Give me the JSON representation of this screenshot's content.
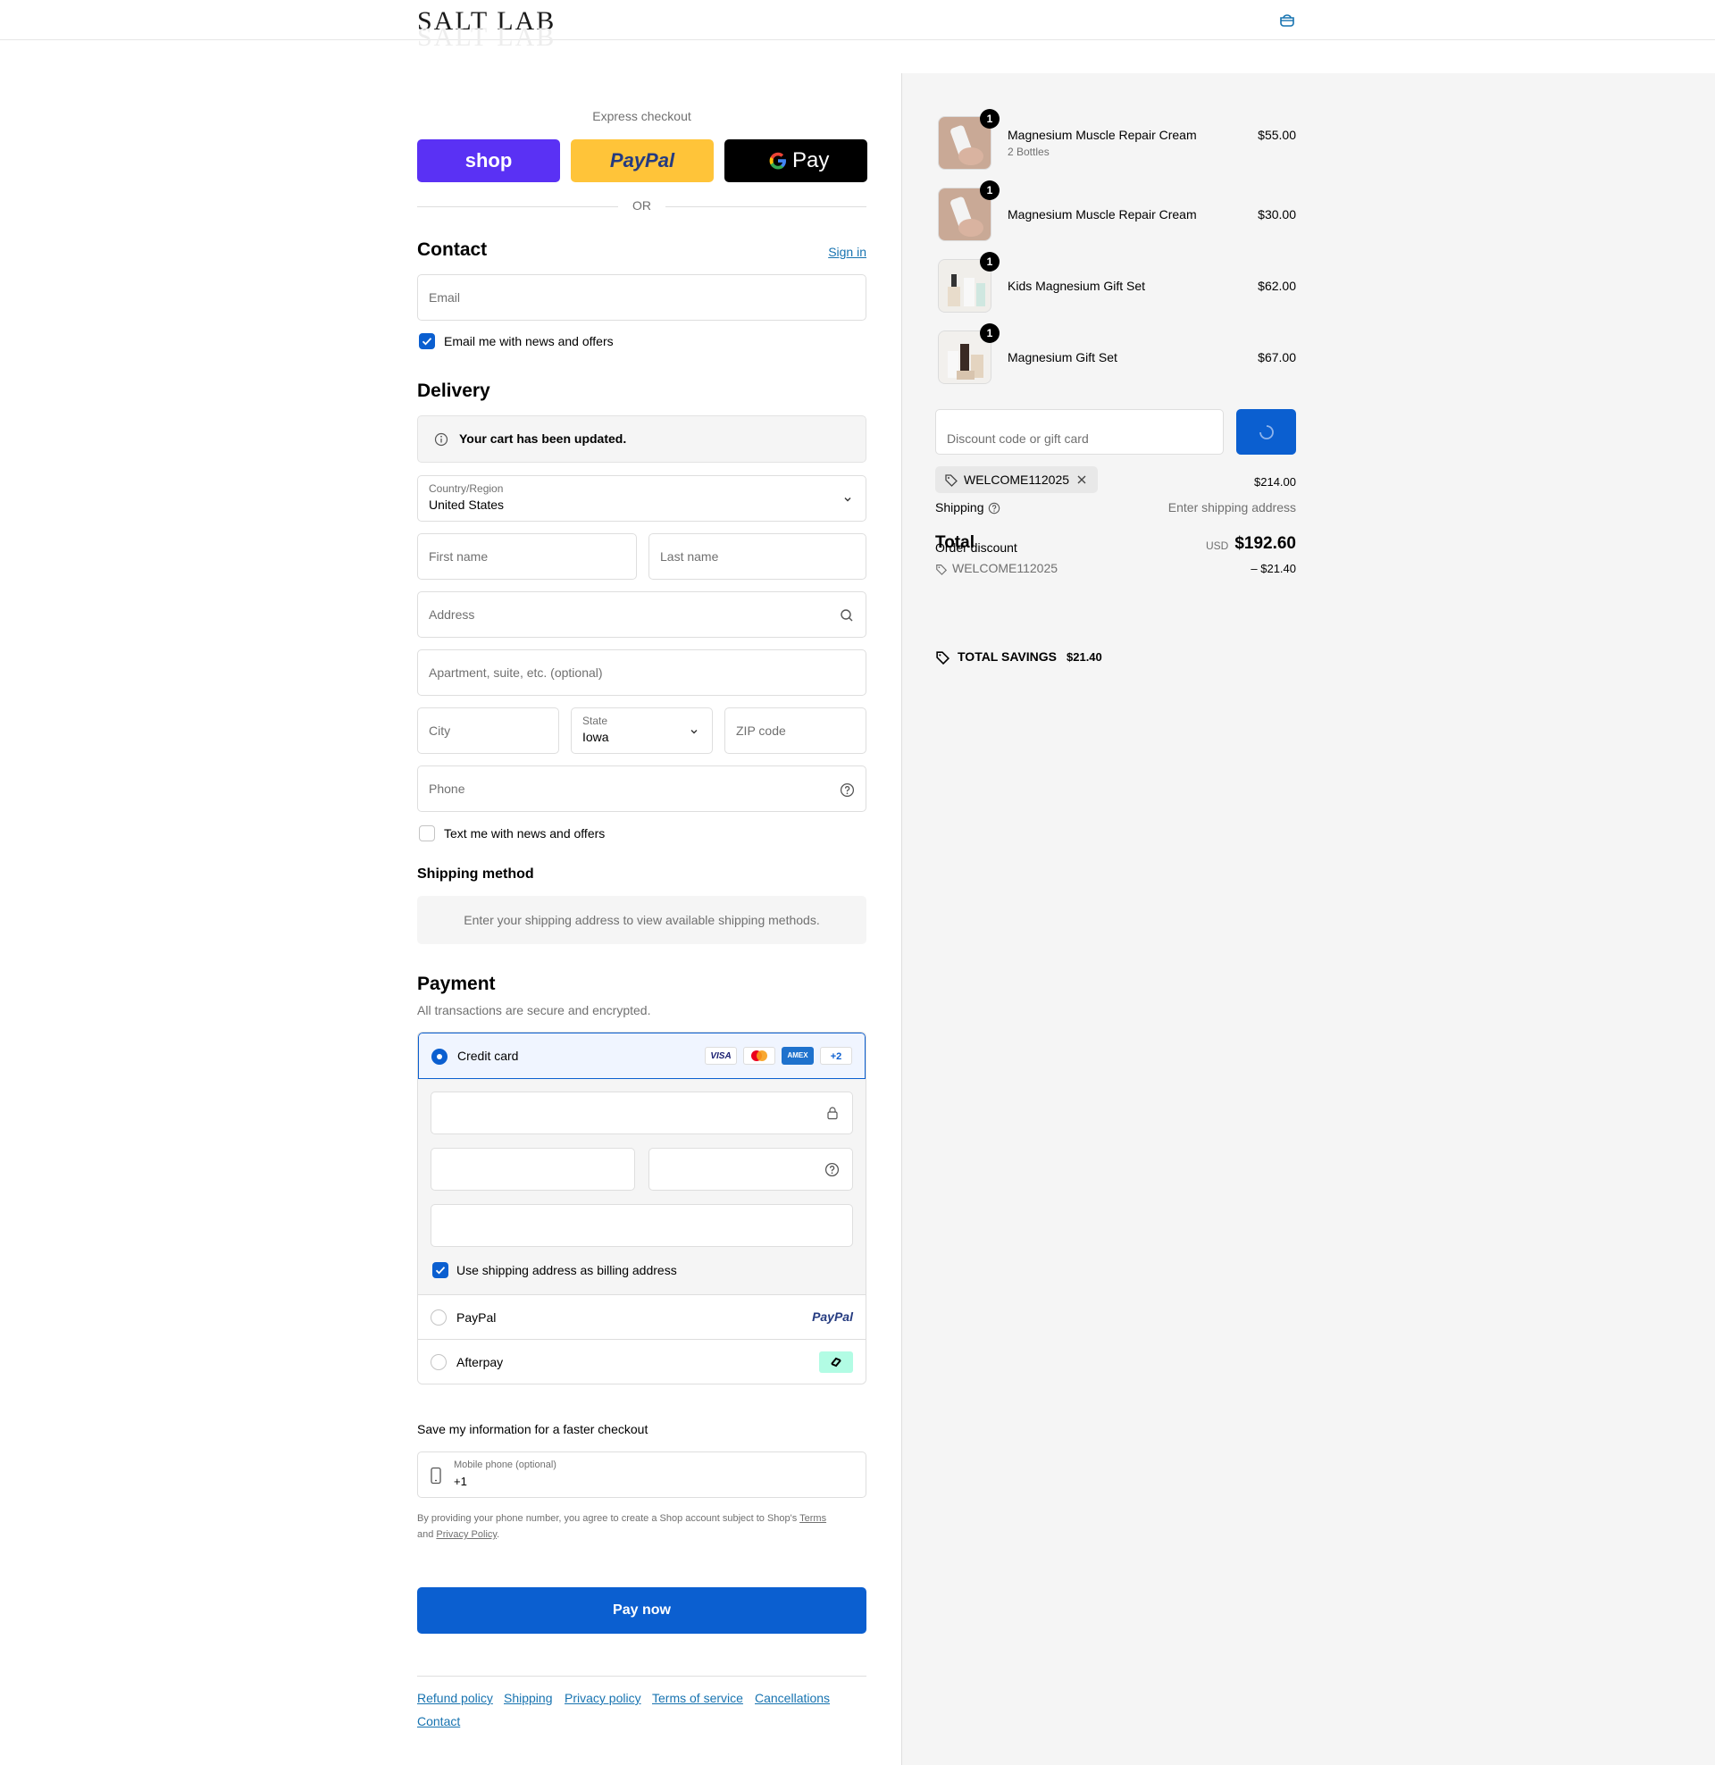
{
  "brand": {
    "logo": "SALT LAB"
  },
  "icons": {
    "cart": "shopping-bag-icon"
  },
  "express": {
    "title": "Express checkout",
    "shop_label": "shop",
    "paypal_label": "PayPal",
    "gpay_label": "Pay",
    "or": "OR"
  },
  "contact": {
    "heading": "Contact",
    "sign_in": "Sign in",
    "email_placeholder": "Email",
    "news_label": "Email me with news and offers"
  },
  "delivery": {
    "heading": "Delivery",
    "notice": "Your cart has been updated.",
    "country_label": "Country/Region",
    "country_value": "United States",
    "first_name": "First name",
    "last_name": "Last name",
    "address": "Address",
    "apartment": "Apartment, suite, etc. (optional)",
    "city": "City",
    "state_label": "State",
    "state_value": "Iowa",
    "zip": "ZIP code",
    "phone": "Phone",
    "text_label": "Text me with news and offers"
  },
  "shipping_method": {
    "heading": "Shipping method",
    "message": "Enter your shipping address to view available shipping methods."
  },
  "payment": {
    "heading": "Payment",
    "subtitle": "All transactions are secure and encrypted.",
    "credit_card": "Credit card",
    "cards": [
      "VISA",
      "MC",
      "AMEX",
      "+2"
    ],
    "billing_label": "Use shipping address as billing address",
    "paypal": "PayPal",
    "paypal_logo": "PayPal",
    "afterpay": "Afterpay"
  },
  "save_info": {
    "heading": "Save my information for a faster checkout",
    "mobile_label": "Mobile phone (optional)",
    "mobile_value": "+1",
    "disclaimer_pre": "By providing your phone number, you agree to create a Shop account subject to Shop's ",
    "terms": "Terms",
    "and": "and ",
    "privacy": "Privacy Policy",
    "period": "."
  },
  "pay_now": "Pay now",
  "footer_links": [
    "Refund policy",
    "Shipping",
    "Privacy policy",
    "Terms of service",
    "Cancellations",
    "Contact"
  ],
  "cart": {
    "items": [
      {
        "name": "Magnesium Muscle Repair Cream",
        "variant": "2 Bottles",
        "price": "$55.00",
        "qty": "1"
      },
      {
        "name": "Magnesium Muscle Repair Cream",
        "variant": "",
        "price": "$30.00",
        "qty": "1"
      },
      {
        "name": "Kids Magnesium Gift Set",
        "variant": "",
        "price": "$62.00",
        "qty": "1"
      },
      {
        "name": "Magnesium Gift Set",
        "variant": "",
        "price": "$67.00",
        "qty": "1"
      }
    ],
    "discount_placeholder": "Discount code or gift card",
    "applied_code": "WELCOME112025",
    "subtotal_value": "$214.00",
    "shipping_label": "Shipping",
    "shipping_value": "Enter shipping address",
    "total_label": "Total",
    "currency": "USD",
    "total_value": "$192.60",
    "order_discount_label": "Order discount",
    "discount_code": "WELCOME112025",
    "discount_value": "– $21.40",
    "savings_label": "TOTAL SAVINGS",
    "savings_value": "$21.40"
  },
  "colors": {
    "accent": "#0b5fd0",
    "shop": "#5a31f4",
    "paypal": "#ffc439",
    "link": "#1773b0",
    "afterpay": "#b2fce4"
  }
}
